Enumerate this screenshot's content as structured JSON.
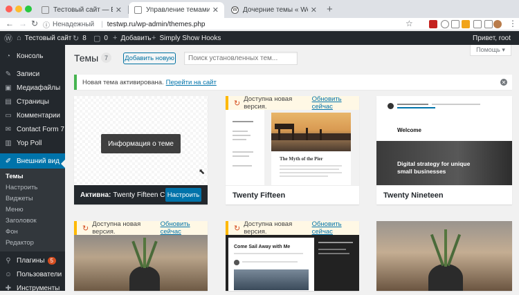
{
  "browser": {
    "tabs": [
      {
        "title": "Тестовый сайт — Ещё один с",
        "active": false
      },
      {
        "title": "Управление темами ‹ Тестов",
        "active": true
      },
      {
        "title": "Дочерние темы « WordPress",
        "active": false
      }
    ],
    "new_tab": "+",
    "address": {
      "security": "Ненадежный",
      "url": "testwp.ru/wp-admin/themes.php"
    }
  },
  "adminbar": {
    "site_name": "Тестовый сайт",
    "updates_count": "8",
    "comments_count": "0",
    "add_new": "Добавить",
    "plugin": "Simply Show Hooks",
    "greeting": "Привет, root"
  },
  "sidebar": {
    "items": [
      {
        "label": "Консоль",
        "icon": "dashboard-icon"
      },
      {
        "label": "Записи",
        "icon": "pin-icon"
      },
      {
        "label": "Медиафайлы",
        "icon": "media-icon"
      },
      {
        "label": "Страницы",
        "icon": "page-icon"
      },
      {
        "label": "Комментарии",
        "icon": "comment-icon"
      },
      {
        "label": "Contact Form 7",
        "icon": "mail-icon"
      },
      {
        "label": "Yop Poll",
        "icon": "poll-icon"
      },
      {
        "label": "Внешний вид",
        "icon": "brush-icon"
      }
    ],
    "submenu": [
      "Темы",
      "Настроить",
      "Виджеты",
      "Меню",
      "Заголовок",
      "Фон",
      "Редактор"
    ],
    "bottom_items": [
      {
        "label": "Плагины",
        "badge": "5",
        "icon": "plugin-icon"
      },
      {
        "label": "Пользователи",
        "icon": "users-icon"
      },
      {
        "label": "Инструменты",
        "icon": "tools-icon"
      }
    ]
  },
  "main": {
    "title": "Темы",
    "count": "7",
    "add_new": "Добавить новую",
    "search_placeholder": "Поиск установленных тем...",
    "help": "Помощь ▾",
    "notice_text": "Новая тема активирована.",
    "notice_link": "Перейти на сайт",
    "update_text": "Доступна новая версия.",
    "update_link": "Обновить сейчас",
    "active_theme": {
      "overlay_button": "Информация о теме",
      "active_label": "Активна:",
      "name": "Twenty Fifteen C",
      "customize": "Настроить"
    },
    "themes": [
      {
        "name": "Twenty Fifteen",
        "preview_heading": "The Myth of the Pier"
      },
      {
        "name": "Twenty Nineteen",
        "preview_heading": "Welcome",
        "preview_tagline": "Digital strategy for unique small businesses"
      }
    ],
    "row2_preview_heading": "Come Sail Away with Me"
  },
  "colors": {
    "admin_bar": "#23282d",
    "menu_current": "#0073aa",
    "notice_green": "#46b450",
    "update_yellow": "#ffb900"
  }
}
